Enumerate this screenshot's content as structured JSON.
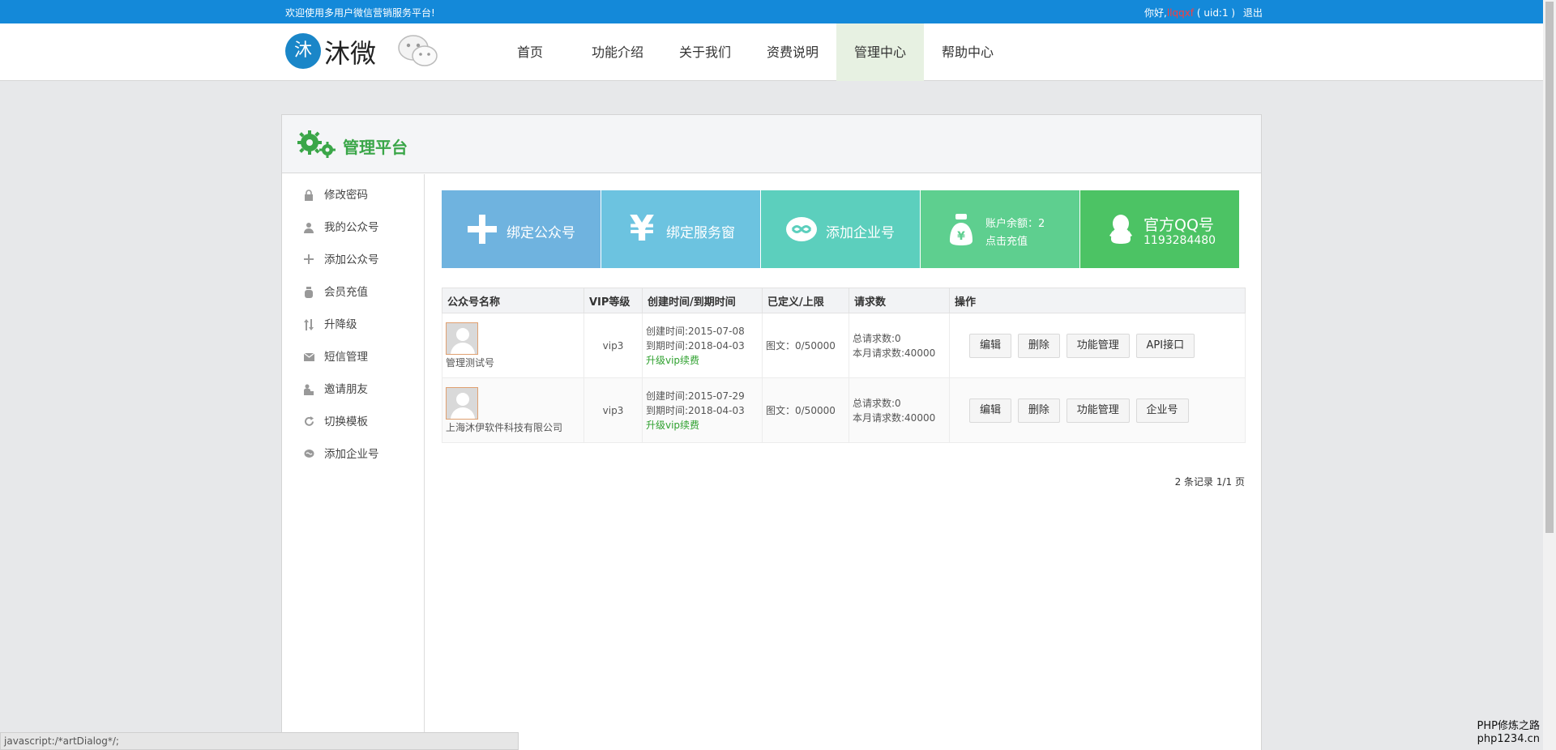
{
  "topbar": {
    "welcome": "欢迎使用多用户微信营销服务平台!",
    "greeting": "你好,",
    "username": "llqqxf",
    "uid": " ( uid:1 ) ",
    "logout": "退出"
  },
  "header": {
    "logo_mark": "沐",
    "logo_text": "沐微",
    "nav": [
      {
        "label": "首页"
      },
      {
        "label": "功能介绍"
      },
      {
        "label": "关于我们"
      },
      {
        "label": "资费说明"
      },
      {
        "label": "管理中心"
      },
      {
        "label": "帮助中心"
      }
    ],
    "active_nav": "管理中心"
  },
  "panel": {
    "title": "管理平台"
  },
  "sidebar": {
    "items": [
      {
        "label": "修改密码",
        "icon": "lock-icon"
      },
      {
        "label": "我的公众号",
        "icon": "user-icon"
      },
      {
        "label": "添加公众号",
        "icon": "plus-icon"
      },
      {
        "label": "会员充值",
        "icon": "moneybag-icon"
      },
      {
        "label": "升降级",
        "icon": "updown-icon"
      },
      {
        "label": "短信管理",
        "icon": "envelope-icon"
      },
      {
        "label": "邀请朋友",
        "icon": "invite-icon"
      },
      {
        "label": "切换模板",
        "icon": "refresh-icon"
      },
      {
        "label": "添加企业号",
        "icon": "chat-icon"
      }
    ]
  },
  "tiles": {
    "bind_account": "绑定公众号",
    "bind_service": "绑定服务窗",
    "add_enterprise": "添加企业号",
    "balance_label": "账户余额：2",
    "recharge": "点击充值",
    "qq_title": "官方QQ号",
    "qq_number": "1193284480",
    "colors": {
      "bind_account": "#6fb3df",
      "bind_service": "#6cc3e0",
      "add_enterprise": "#5ccfbd",
      "balance": "#5ecf8f",
      "qq": "#4cc364"
    }
  },
  "table": {
    "headers": [
      "公众号名称",
      "VIP等级",
      "创建时间/到期时间",
      "已定义/上限",
      "请求数",
      "操作"
    ],
    "rows": [
      {
        "name": "管理测试号",
        "vip": "vip3",
        "created": "创建时间:2015-07-08",
        "expires": "到期时间:2018-04-03",
        "upgrade": "升级vip续费",
        "defined": "图文：0/50000",
        "total_requests": "总请求数:0",
        "month_requests": "本月请求数:40000",
        "actions": [
          "编辑",
          "删除",
          "功能管理",
          "API接口"
        ]
      },
      {
        "name": "上海沐伊软件科技有限公司",
        "vip": "vip3",
        "created": "创建时间:2015-07-29",
        "expires": "到期时间:2018-04-03",
        "upgrade": "升级vip续费",
        "defined": "图文：0/50000",
        "total_requests": "总请求数:0",
        "month_requests": "本月请求数:40000",
        "actions": [
          "编辑",
          "删除",
          "功能管理",
          "企业号"
        ]
      }
    ]
  },
  "pager": "2 条记录 1/1 页",
  "statusbar": "javascript:/*artDialog*/;",
  "watermark": {
    "line1": "PHP修炼之路",
    "line2": "php1234.cn"
  }
}
